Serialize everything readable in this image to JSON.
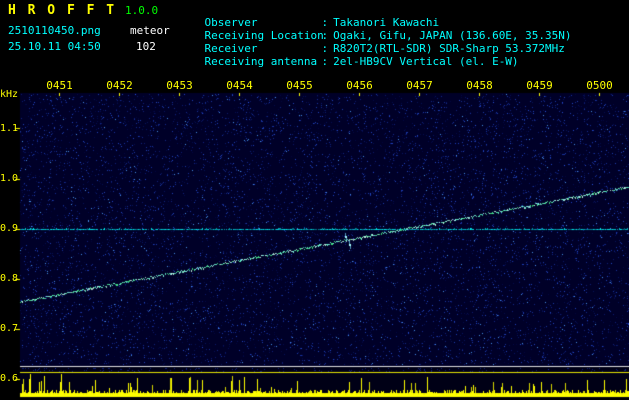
{
  "header": {
    "app_title": "H R O F F T",
    "version": "1.0.0",
    "filename": "2510110450.png",
    "mode": "meteor",
    "datetime": "25.10.11 04:50",
    "count": "102",
    "colon": ":",
    "info": [
      {
        "label": "Observer",
        "value": "Takanori Kawachi"
      },
      {
        "label": "Receiving Location",
        "value": "Ogaki, Gifu, JAPAN (136.60E, 35.35N)"
      },
      {
        "label": "Receiver",
        "value": "R820T2(RTL-SDR) SDR-Sharp 53.372MHz"
      },
      {
        "label": "Receiving antenna",
        "value": "2el-HB9CV Vertical (el. E-W)"
      }
    ]
  },
  "chart_data": {
    "type": "heatmap",
    "ylabel": "kHz",
    "x_tick_labels": [
      "0451",
      "0452",
      "0453",
      "0454",
      "0455",
      "0456",
      "0457",
      "0458",
      "0459",
      "0500"
    ],
    "y_tick_labels": [
      "1.1",
      "1.0",
      "0.9",
      "0.8",
      "0.7",
      "0.6"
    ],
    "y_tick_values_khz": [
      1.1,
      1.0,
      0.9,
      0.8,
      0.7,
      0.6
    ],
    "ylim_khz": [
      0.57,
      1.17
    ],
    "x_start_time": "04:50",
    "x_end_time": "05:00",
    "grid": false,
    "carrier_line_khz": 0.9,
    "drift_line_khz": {
      "start": 0.754,
      "end": 0.984
    },
    "echo_marks": [
      {
        "x_frac": 0.535,
        "khz": 0.886
      },
      {
        "x_frac": 0.541,
        "khz": 0.87
      }
    ],
    "noise_strip_position": "bottom",
    "colors": {
      "background": "#000000",
      "plot_bg": "#000028",
      "strip_bg": "#000016",
      "noise": "#2244ff",
      "carrier_line": "#00ffff",
      "drift_line": "#66ffcc",
      "bars": "#ffff00",
      "axis_text": "#ffff00",
      "title": "#ffff00",
      "version": "#00ff00",
      "filename": "#00ffff",
      "info_text": "#00ffff",
      "white_line": "#e0e0e0"
    }
  }
}
